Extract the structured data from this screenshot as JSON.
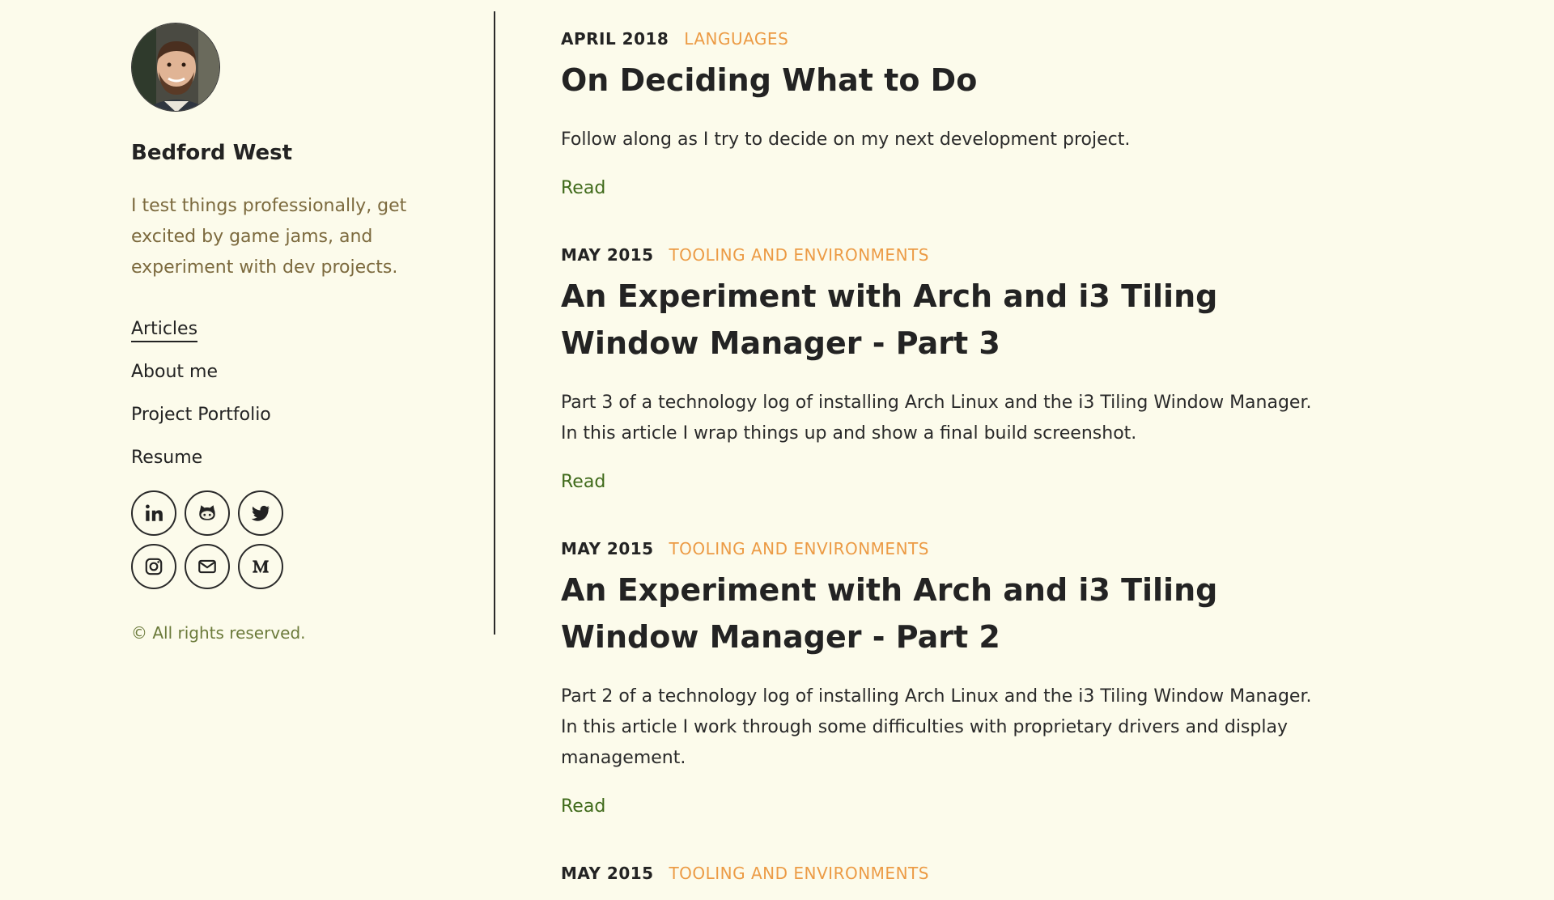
{
  "sidebar": {
    "author_name": "Bedford West",
    "bio": "I test things professionally, get excited by game jams, and experiment with dev projects.",
    "nav": [
      {
        "label": "Articles",
        "active": true
      },
      {
        "label": "About me",
        "active": false
      },
      {
        "label": "Project Portfolio",
        "active": false
      },
      {
        "label": "Resume",
        "active": false
      }
    ],
    "social_icons": [
      "linkedin-icon",
      "github-icon",
      "twitter-icon",
      "instagram-icon",
      "email-icon",
      "medium-icon"
    ],
    "copyright": "© All rights reserved."
  },
  "posts": [
    {
      "date": "APRIL 2018",
      "category": "LANGUAGES",
      "title": "On Deciding What to Do",
      "excerpt": "Follow along as I try to decide on my next development project.",
      "read_label": "Read"
    },
    {
      "date": "MAY 2015",
      "category": "TOOLING AND ENVIRONMENTS",
      "title": "An Experiment with Arch and i3 Tiling Window Manager - Part 3",
      "excerpt": "Part 3 of a technology log of installing Arch Linux and the i3 Tiling Window Manager. In this article I wrap things up and show a final build screenshot.",
      "read_label": "Read"
    },
    {
      "date": "MAY 2015",
      "category": "TOOLING AND ENVIRONMENTS",
      "title": "An Experiment with Arch and i3 Tiling Window Manager - Part 2",
      "excerpt": "Part 2 of a technology log of installing Arch Linux and the i3 Tiling Window Manager. In this article I work through some difficulties with proprietary drivers and display management.",
      "read_label": "Read"
    },
    {
      "date": "MAY 2015",
      "category": "TOOLING AND ENVIRONMENTS"
    }
  ],
  "colors": {
    "background": "#fcfbeb",
    "category": "#ec9b45",
    "link": "#3f6a1a",
    "bio": "#7c6a3e"
  }
}
